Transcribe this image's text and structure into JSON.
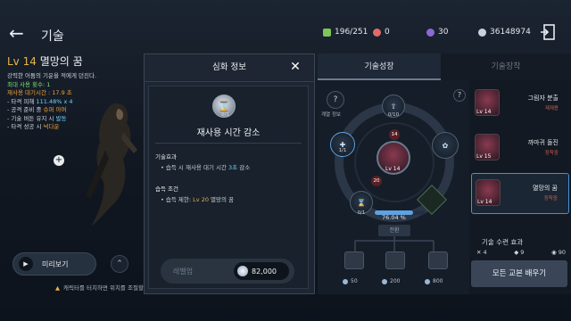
{
  "header": {
    "back_icon": "arrow-left-icon",
    "title": "기술",
    "resources": [
      {
        "icon": "green-gem-icon",
        "color": "#7ec45a",
        "value": "196/251"
      },
      {
        "icon": "red-orb-icon",
        "color": "#e06a6a",
        "value": "0"
      },
      {
        "icon": "purple-orb-icon",
        "color": "#8a6ad0",
        "value": "30"
      },
      {
        "icon": "silver-coin-icon",
        "color": "#c9d2dc",
        "value": "36148974"
      }
    ],
    "exit_icon": "exit-door-icon"
  },
  "skill": {
    "level": "Lv 14",
    "name": "멸망의 꿈",
    "desc_line1": "강력한 어둠의 기운을 적에게 던진다.",
    "desc_line2": "최대 사용 횟수: 1",
    "desc_line3": "재사용 대기시간 : 17.9 초",
    "desc_line4_a": "- 타격 피해 ",
    "desc_line4_b": "111.48% x 4",
    "desc_line5_a": "- 공격 준비 중 ",
    "desc_line5_b": "슈퍼 아머",
    "desc_line6_a": "- 기술 버튼 유지 시 ",
    "desc_line6_b": "발동",
    "desc_line7_a": "- 타격 성공 시 ",
    "desc_line7_b": "넉다운"
  },
  "left_controls": {
    "preview_label": "미리보기",
    "preview_icon": "play-icon",
    "up_icon": "double-chevron-up-icon",
    "hint_icon": "warning-icon",
    "hint": "캐릭터를 터치하면 위치를 조절할 수 있습니다"
  },
  "modal": {
    "title": "심화 정보",
    "close_icon": "close-icon",
    "icon": "hourglass-icon",
    "icon_count": "0/1",
    "skill_name": "재사용 시간 감소",
    "sec1_title": "기술효과",
    "sec1_a": "• 습득 시 재사용 대기 시간 ",
    "sec1_b": "3초",
    "sec1_c": " 감소",
    "sec2_title": "습득 조건",
    "sec2_a": "• 습득 제한: ",
    "sec2_b": "Lv 20",
    "sec2_c": " 멸망의 꿈",
    "levelup_label": "레벨업",
    "cost_icon": "silver-coin-icon",
    "cost": "82,000"
  },
  "tabs": {
    "growth": "기술성장",
    "equip": "기술장착"
  },
  "tree": {
    "help_icon": "question-icon",
    "help_label": "계열 정보",
    "top_count": "0/10",
    "left_count": "1/1",
    "bottom_count": "0/1",
    "center_level": "Lv 14",
    "red_top": "14",
    "red_left": "20",
    "progress": "76.04 %",
    "progress_value": 0.7604,
    "bottom_btn": "전환",
    "slots": [
      {
        "icon": "book-slot-icon",
        "cost": "50"
      },
      {
        "icon": "book-slot-icon",
        "cost": "200"
      },
      {
        "icon": "book-slot-icon",
        "cost": "800"
      }
    ]
  },
  "skill_list": [
    {
      "name": "그림자 분출",
      "type": "제재용",
      "level": "Lv 14"
    },
    {
      "name": "까마귀 돌진",
      "type": "장착중",
      "level": "Lv 15"
    },
    {
      "name": "멸망의 꿈",
      "type": "장착중",
      "level": "Lv 14"
    }
  ],
  "training": {
    "label": "기술 수련 효과",
    "v1": "4",
    "v2": "9",
    "v3": "90",
    "reset_label": "모든 교본 배우기"
  }
}
